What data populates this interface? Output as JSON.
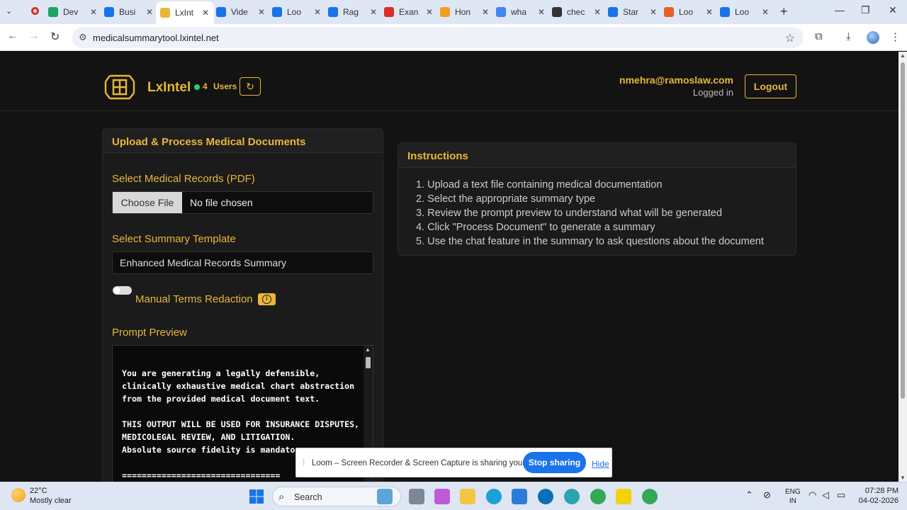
{
  "browser": {
    "tabs": [
      {
        "label": "Dev",
        "color": "#1ea362"
      },
      {
        "label": "Busi",
        "color": "#1a73e8"
      },
      {
        "label": "LxInt",
        "color": "#e8b73a",
        "active": true
      },
      {
        "label": "Vide",
        "color": "#1a73e8"
      },
      {
        "label": "Loo",
        "color": "#1a73e8"
      },
      {
        "label": "Rag",
        "color": "#1a73e8"
      },
      {
        "label": "Exan",
        "color": "#d93025"
      },
      {
        "label": "Hon",
        "color": "#f0a020"
      },
      {
        "label": "wha",
        "color": "#4285f4"
      },
      {
        "label": "chec",
        "color": "#333333"
      },
      {
        "label": "Star",
        "color": "#1a73e8"
      },
      {
        "label": "Loo",
        "color": "#e85d2a"
      },
      {
        "label": "Loo",
        "color": "#1a73e8"
      }
    ],
    "url": "medicalsummarytool.lxintel.net"
  },
  "header": {
    "brand": "LxIntel",
    "users_count": "4",
    "users_label": "Users",
    "email": "nmehra@ramoslaw.com",
    "login_status": "Logged in",
    "logout_label": "Logout"
  },
  "upload": {
    "title": "Upload & Process Medical Documents",
    "records_label": "Select Medical Records (PDF)",
    "choose_file": "Choose File",
    "no_file": "No file chosen",
    "template_label": "Select Summary Template",
    "template_value": "Enhanced Medical Records Summary",
    "redaction_label": "Manual Terms Redaction",
    "prompt_label": "Prompt Preview",
    "prompt_text": "You are generating a legally defensible,\nclinically exhaustive medical chart abstraction\nfrom the provided medical document text.\n\nTHIS OUTPUT WILL BE USED FOR INSURANCE DISPUTES,\nMEDICOLEGAL REVIEW, AND LITIGATION.\nAbsolute source fidelity is mandatory.\n\n================================"
  },
  "instructions": {
    "title": "Instructions",
    "items": [
      "1. Upload a text file containing medical documentation",
      "2. Select the appropriate summary type",
      "3. Review the prompt preview to understand what will be generated",
      "4. Click \"Process Document\" to generate a summary",
      "5. Use the chat feature in the summary to ask questions about the document"
    ]
  },
  "loom": {
    "message": "Loom – Screen Recorder & Screen Capture is sharing your screen.",
    "stop_label": "Stop sharing",
    "hide_label": "Hide"
  },
  "taskbar": {
    "temp": "22°C",
    "weather": "Mostly clear",
    "search": "Search",
    "lang1": "ENG",
    "lang2": "IN",
    "time": "07:28 PM",
    "date": "04-02-2026"
  },
  "colors": {
    "accent": "#e8b73a",
    "background": "#131313",
    "card": "#1b1b1b"
  }
}
